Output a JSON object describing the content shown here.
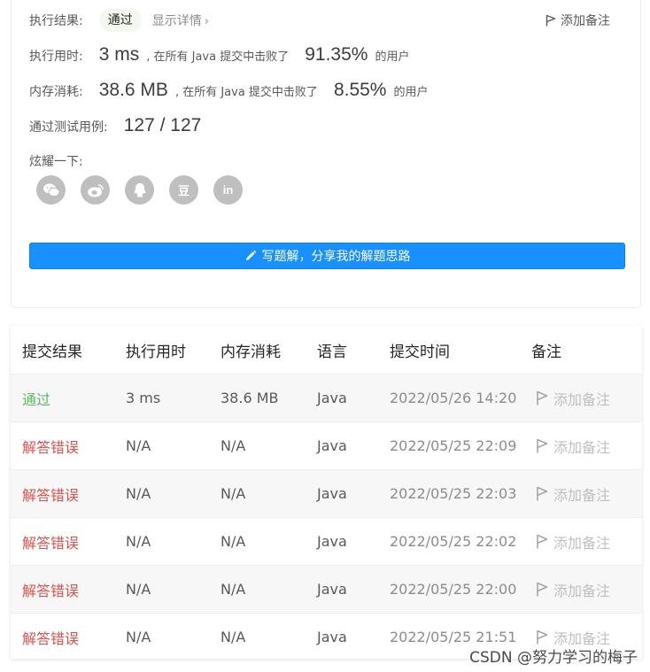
{
  "summary": {
    "result_label": "执行结果:",
    "status": "通过",
    "details_link": "显示详情",
    "details_chevron": "›",
    "add_note": "添加备注",
    "runtime_label": "执行用时:",
    "runtime_value": "3 ms",
    "runtime_mid": ", 在所有 Java 提交中击败了",
    "runtime_pct": "91.35%",
    "runtime_tail": "的用户",
    "memory_label": "内存消耗:",
    "memory_value": "38.6 MB",
    "memory_mid": ", 在所有 Java 提交中击败了",
    "memory_pct": "8.55%",
    "memory_tail": "的用户",
    "tests_label": "通过测试用例:",
    "tests_value": "127 / 127",
    "share_label": "炫耀一下:",
    "share_icons": [
      "wechat-icon",
      "weibo-icon",
      "qq-icon",
      "douban-icon",
      "linkedin-icon"
    ],
    "douban_glyph": "豆",
    "linkedin_glyph": "in",
    "write_button": "写题解，分享我的解题思路"
  },
  "table": {
    "headers": [
      "提交结果",
      "执行用时",
      "内存消耗",
      "语言",
      "提交时间",
      "备注"
    ],
    "rows": [
      {
        "status": "通过",
        "runtime": "3 ms",
        "memory": "38.6 MB",
        "lang": "Java",
        "time": "2022/05/26 14:20",
        "note": "添加备注"
      },
      {
        "status": "解答错误",
        "runtime": "N/A",
        "memory": "N/A",
        "lang": "Java",
        "time": "2022/05/25 22:09",
        "note": "添加备注"
      },
      {
        "status": "解答错误",
        "runtime": "N/A",
        "memory": "N/A",
        "lang": "Java",
        "time": "2022/05/25 22:03",
        "note": "添加备注"
      },
      {
        "status": "解答错误",
        "runtime": "N/A",
        "memory": "N/A",
        "lang": "Java",
        "time": "2022/05/25 22:02",
        "note": "添加备注"
      },
      {
        "status": "解答错误",
        "runtime": "N/A",
        "memory": "N/A",
        "lang": "Java",
        "time": "2022/05/25 22:00",
        "note": "添加备注"
      },
      {
        "status": "解答错误",
        "runtime": "N/A",
        "memory": "N/A",
        "lang": "Java",
        "time": "2022/05/25 21:51",
        "note": "添加备注"
      }
    ]
  },
  "watermark": "CSDN @努力学习的梅子",
  "colors": {
    "accent": "#1890ff",
    "pass": "#5cb85c",
    "error": "#d9534f",
    "share_icon_bg": "#bfbfbf"
  }
}
